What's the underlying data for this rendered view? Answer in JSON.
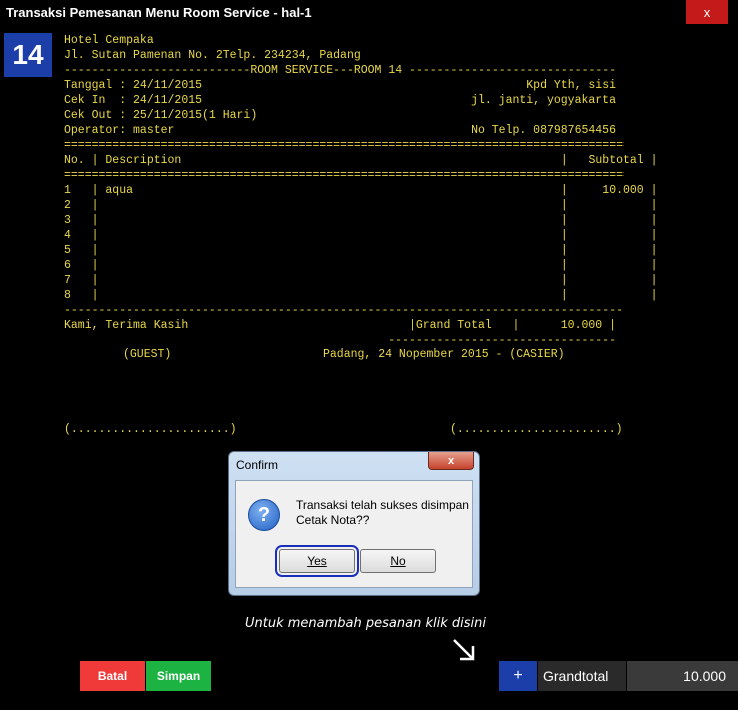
{
  "window": {
    "title": "Transaksi Pemesanan Menu Room Service - hal-1",
    "close_label": "x",
    "room_number": "14"
  },
  "receipt": {
    "hotel_name": "Hotel Cempaka",
    "address": "Jl. Sutan Pamenan No. 2Telp. 234234, Padang",
    "service_header": "---------------------------ROOM SERVICE---ROOM 14 ------------------------------",
    "tanggal": "Tanggal : 24/11/2015",
    "cek_in": "Cek In  : 24/11/2015",
    "cek_out": "Cek Out : 25/11/2015(1 Hari)",
    "operator": "Operator: master",
    "kpd": "Kpd Yth, sisi",
    "guest_address": "jl. janti, yogyakarta",
    "guest_phone": "No Telp. 087987654456",
    "double_rule": "=====================================================================================",
    "single_rule": "-------------------------------------------------------------------------------------",
    "short_rule": "---------------------------------",
    "col_header": "No. | Description                                                       |   Subtotal |",
    "rows": [
      "1   | aqua                                                              |     10.000 |",
      "2   |                                                                   |            |",
      "3   |                                                                   |            |",
      "4   |                                                                   |            |",
      "5   |                                                                   |            |",
      "6   |                                                                   |            |",
      "7   |                                                                   |            |",
      "8   |                                                                   |            |"
    ],
    "thanks": "Kami, Terima Kasih",
    "grand_total_row": "|Grand Total   |      10.000 |",
    "guest_label": "(GUEST)",
    "casier_label": "Padang, 24 Nopember 2015 - (CASIER)",
    "sign_left": "(.......................)",
    "sign_right": "(.......................)"
  },
  "dialog": {
    "title": "Confirm",
    "close_label": "x",
    "icon": "question-icon",
    "message_line1": "Transaksi telah sukses disimpan",
    "message_line2": "Cetak Nota??",
    "yes_label": "Yes",
    "no_label": "No"
  },
  "footer": {
    "hint": "Untuk menambah pesanan klik disini",
    "batal_label": "Batal",
    "simpan_label": "Simpan",
    "plus_label": "+",
    "grandtotal_label": "Grandtotal",
    "grandtotal_value": "10.000"
  },
  "colors": {
    "receipt_text": "#e8d84a",
    "batal": "#f03a3a",
    "simpan": "#1db343",
    "accent_blue": "#1c3ea8",
    "close_red": "#c41a1a"
  }
}
